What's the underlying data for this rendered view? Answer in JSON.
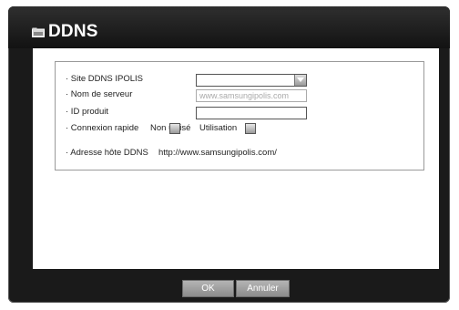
{
  "dialog": {
    "title": "DDNS",
    "title_icon": "folder-icon"
  },
  "form": {
    "site_label": "· Site DDNS  IPOLIS",
    "site_value": "",
    "server_label": "· Nom de serveur",
    "server_value": "www.samsungipolis.com",
    "product_id_label": "· ID produit",
    "product_id_value": "",
    "quick_connect_label": "· Connexion rapide",
    "not_used_label": "Non utilisé",
    "use_label": "Utilisation",
    "host_address_label": "· Adresse hôte DDNS",
    "host_address_value": "http://www.samsungipolis.com/"
  },
  "buttons": {
    "ok": "OK",
    "cancel": "Annuler"
  }
}
